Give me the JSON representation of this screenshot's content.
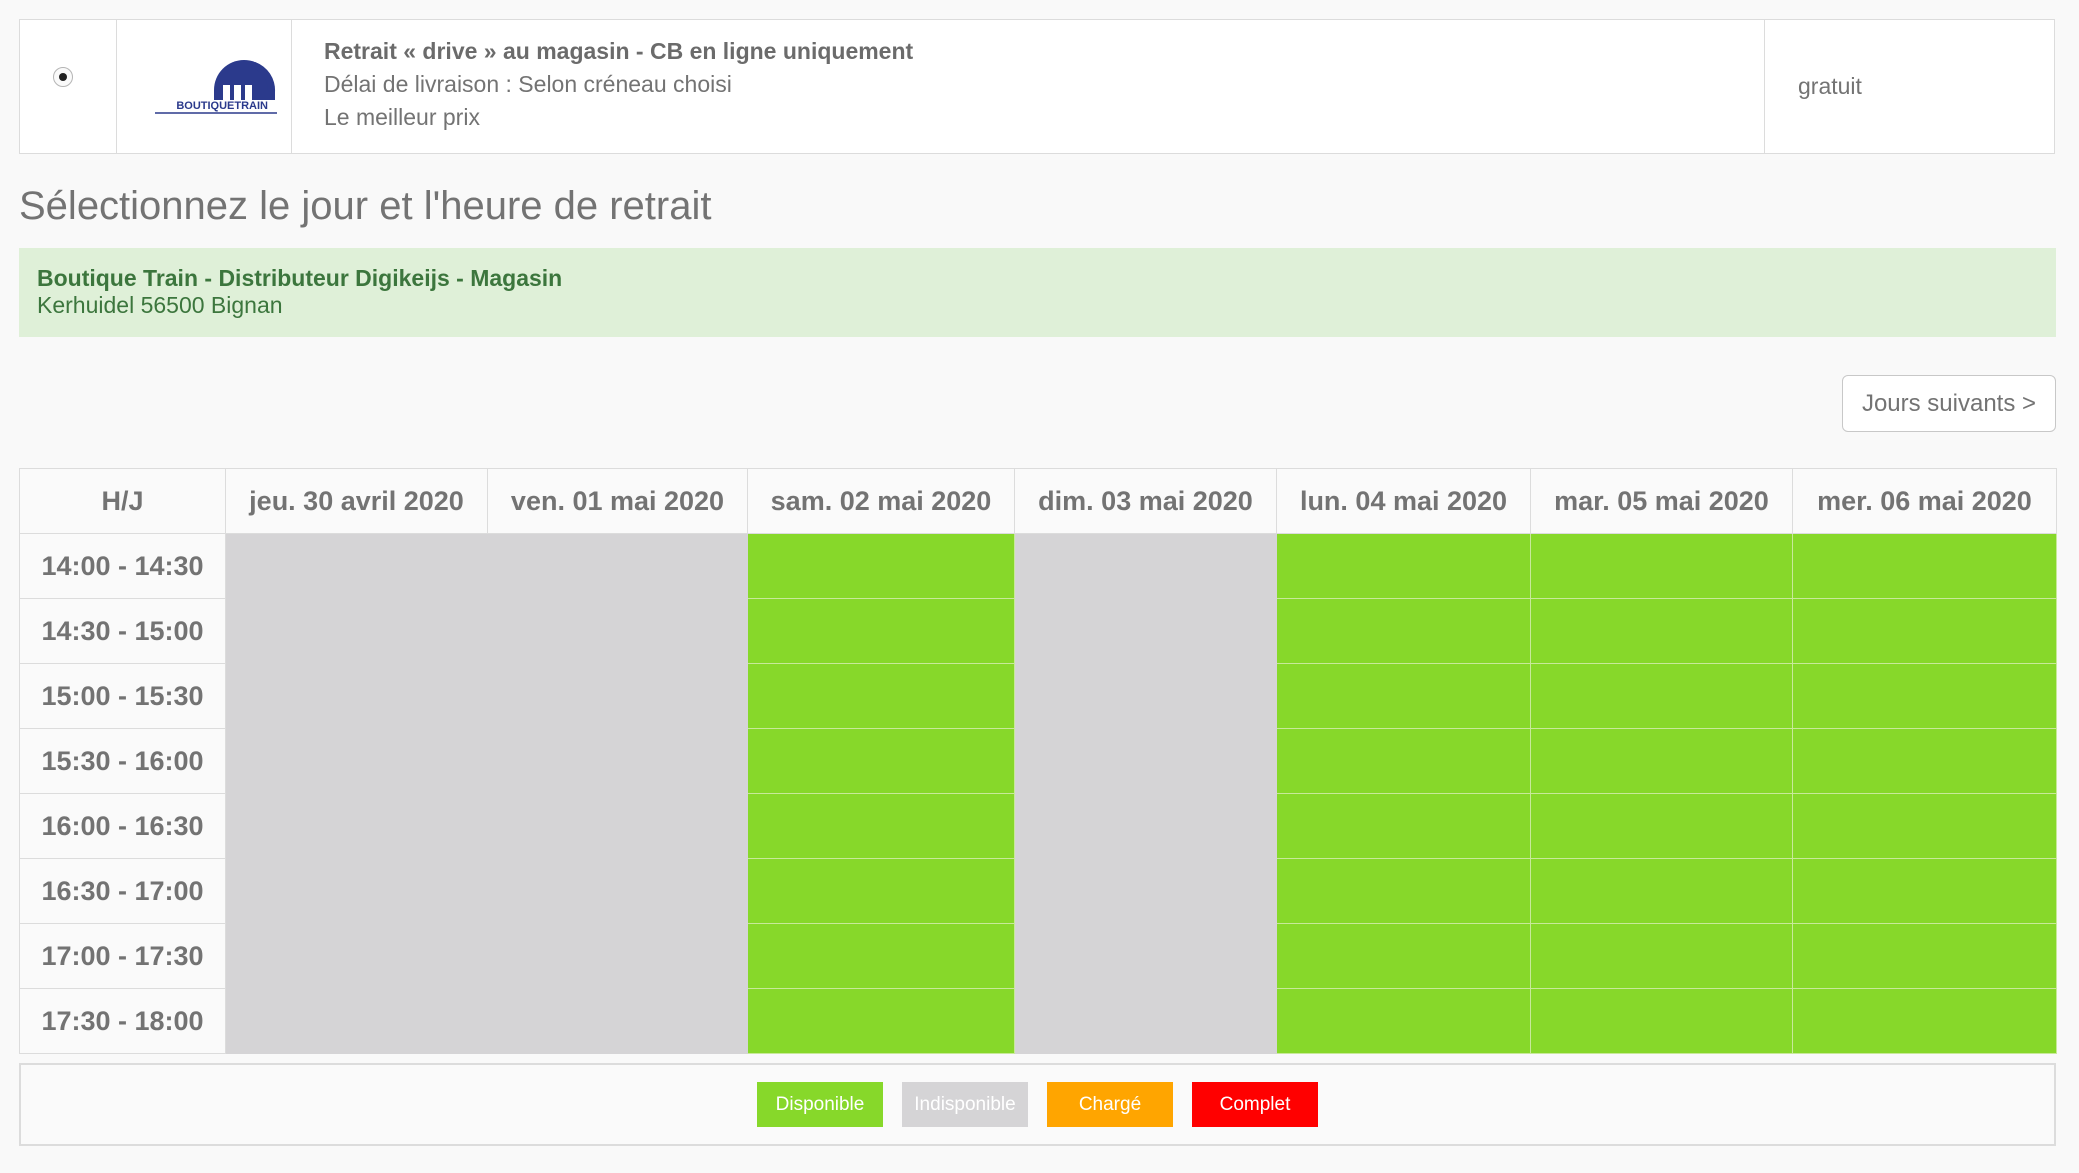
{
  "shipping": {
    "title": "Retrait « drive » au magasin - CB en ligne uniquement",
    "delay": "Délai de livraison : Selon créneau choisi",
    "tagline": "Le meilleur prix",
    "price": "gratuit",
    "logo_text": "BOUTIQUETRAIN",
    "logo_color": "#2b3a8c"
  },
  "section_title": "Sélectionnez le jour et l'heure de retrait",
  "store": {
    "name": "Boutique Train - Distributeur Digikeijs - Magasin",
    "address": "Kerhuidel 56500 Bignan"
  },
  "next_days_label": "Jours suivants >",
  "schedule": {
    "corner_label": "H/J",
    "days": [
      {
        "label": "jeu. 30 avril 2020",
        "status": "unavailable"
      },
      {
        "label": "ven. 01 mai 2020",
        "status": "unavailable"
      },
      {
        "label": "sam. 02 mai 2020",
        "status": "available"
      },
      {
        "label": "dim. 03 mai 2020",
        "status": "unavailable"
      },
      {
        "label": "lun. 04 mai 2020",
        "status": "available"
      },
      {
        "label": "mar. 05 mai 2020",
        "status": "available"
      },
      {
        "label": "mer. 06 mai 2020",
        "status": "available"
      }
    ],
    "times": [
      "14:00 - 14:30",
      "14:30 - 15:00",
      "15:00 - 15:30",
      "15:30 - 16:00",
      "16:00 - 16:30",
      "16:30 - 17:00",
      "17:00 - 17:30",
      "17:30 - 18:00"
    ]
  },
  "legend": [
    {
      "label": "Disponible",
      "color": "#87d82a"
    },
    {
      "label": "Indisponible",
      "color": "#d5d4d6"
    },
    {
      "label": "Chargé",
      "color": "#ffa500"
    },
    {
      "label": "Complet",
      "color": "#ff0000"
    }
  ]
}
